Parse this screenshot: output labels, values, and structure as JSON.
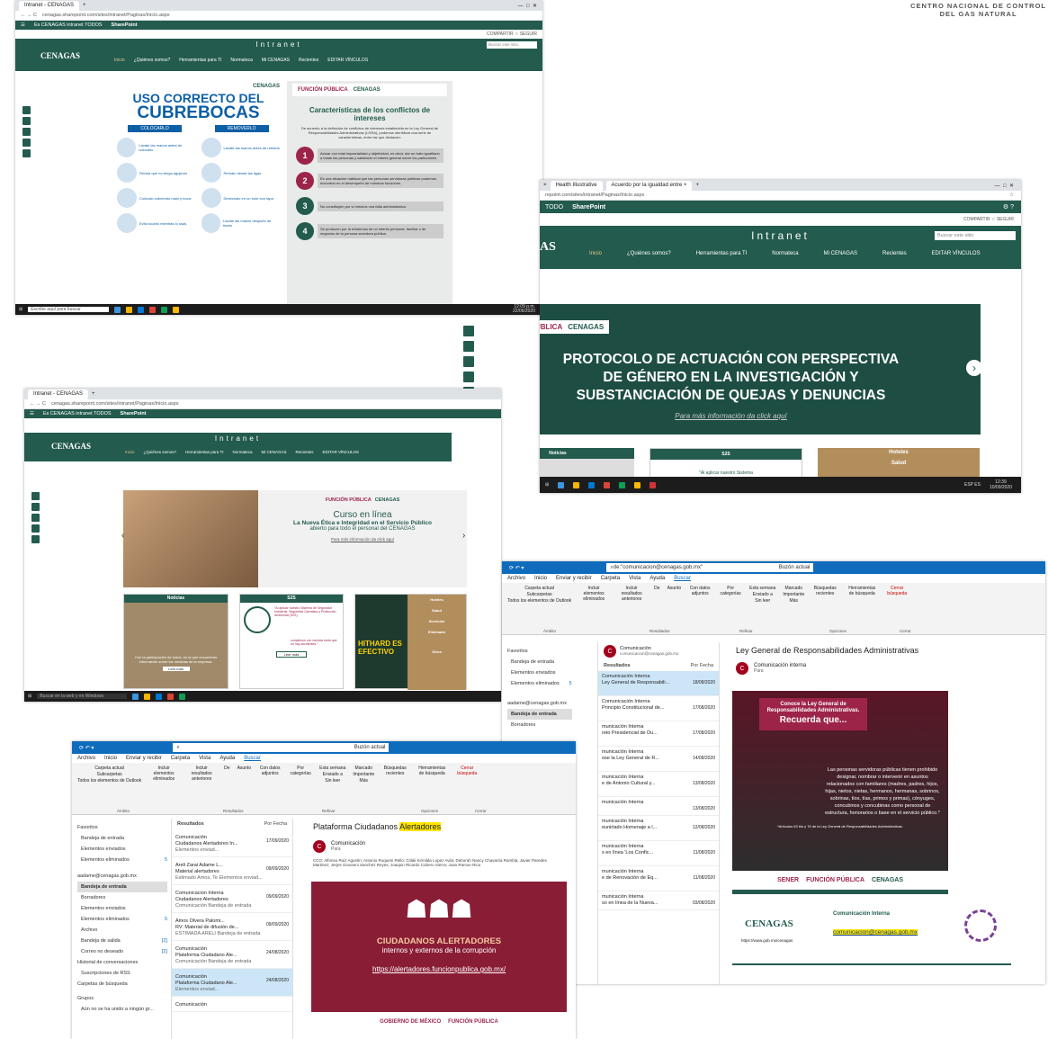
{
  "header_org": [
    "CENTRO NACIONAL DE CONTROL",
    "DEL GAS NATURAL"
  ],
  "s1": {
    "tab": "Intranet - CENAGAS",
    "url": "cenagas.sharepoint.com/sites/intranet/Paginas/Inicio.aspx",
    "sp_left": "Es CENAGAS intranet TODOS",
    "sp": "SharePoint",
    "share": "COMPARTIR ☆ SEGUIR",
    "intranet": "Intranet",
    "search": "Buscar este sitio",
    "logo": "CENAGAS",
    "nav": [
      "Inicio",
      "¿Quiénes somos?",
      "Herramientas para TI",
      "Normateca",
      "Mi CENAGAS",
      "Recientes",
      "EDITAR VÍNCULOS"
    ],
    "poster1": {
      "brand": "CENAGAS",
      "t1": "USO CORRECTO DEL",
      "t2": "CUBREBOCAS",
      "b1": "COLOCARLO",
      "b2": "REMOVERLO",
      "steps": [
        "Lávate las manos antes de colocarlo",
        "Revisa que no tenga agujeros",
        "Colócalo cubriendo nariz y boca",
        "Evita tocarlo mientras lo usas",
        "Lávate las manos antes de retirarlo",
        "Retíralo desde las ligas",
        "Deséchalo en un bote con tapa",
        "Lávate las manos después de tirarlo"
      ]
    },
    "poster2": {
      "fp": "FUNCIÓN PÚBLICA",
      "brand": "CENAGAS",
      "title": "Características de los conflictos de intereses",
      "intro": "De acuerdo a la definición de conflictos de intereses establecida en la Ley General de Responsabilidades Administrativas (LGRA), podemos identificar una serie de características, entre las que destacan:",
      "items": [
        {
          "n": "1",
          "t": "Actuar con total imparcialidad y objetividad, es decir, dar un trato igualitario a todas las personas y satisfacer el interés general sobre los particulares."
        },
        {
          "n": "2",
          "t": "Es una situación habitual que las personas servidoras públicas podemos encontrar en el desempeño de nuestras funciones."
        },
        {
          "n": "3",
          "t": "No constituyen por sí mismos una falta administrativa."
        },
        {
          "n": "4",
          "t": "Se producen por la existencia de un interés personal, familiar o de negocios de la persona servidora pública."
        }
      ]
    },
    "taskbar": "Escribe aquí para buscar",
    "time": "12:09 p.m.",
    "date": "22/06/2020"
  },
  "s2": {
    "tabs": [
      "Health Illustrative",
      "Acuerdo por la igualdad entre ×",
      "+"
    ],
    "url": "repoint.com/sites/intranet/Paginas/Inicio.aspx",
    "sp_left": "TODO",
    "sp": "SharePoint",
    "share": "COMPARTIR ☆ SEGUIR",
    "intranet": "Intranet",
    "search": "Buscar este sitio",
    "logo_frag": "AS",
    "nav": [
      "Inicio",
      "¿Quiénes somos?",
      "Herramientas para TI",
      "Normateca",
      "Mi CENAGAS",
      "Recientes",
      "EDITAR VÍNCULOS"
    ],
    "fp": "FUNCIÓN PÚBLICA",
    "brand": "CENAGAS",
    "b1": "PROTOCOLO DE ACTUACIÓN CON PERSPECTIVA",
    "b2": "DE GÉNERO EN LA INVESTIGACIÓN Y",
    "b3": "SUBSTANCIACIÓN DE QUEJAS Y DENUNCIAS",
    "link": "Para más información da click aquí",
    "cards": [
      "Noticias",
      "S2S",
      "Hoteles"
    ],
    "card_sub": "Salud",
    "card_text": "\"Al aplicar nuestro Sistema",
    "lang": "ESP ES",
    "time": "12:39",
    "date": "10/09/2020"
  },
  "s3": {
    "tab": "Intranet - CENAGAS",
    "url": "cenagas.sharepoint.com/sites/intranet/Paginas/Inicio.aspx",
    "sp_left": "Es CENAGAS intranet TODOS",
    "sp": "SharePoint",
    "intranet": "Intranet",
    "logo": "CENAGAS",
    "nav": [
      "Inicio",
      "¿Quiénes somos?",
      "Herramientas para TI",
      "Normateca",
      "Mi CENAGAS",
      "Recientes",
      "EDITAR VÍNCULOS"
    ],
    "fp": "FUNCIÓN PÚBLICA",
    "brand": "CENAGAS",
    "c1": "Curso en línea",
    "c2": "La Nueva Ética e Integridad en el Servicio Público",
    "c3": "abierto para todo el personal del CENAGAS",
    "c4": "Para más información da click aquí",
    "cards": [
      "Noticias",
      "S2S",
      "Hoteles"
    ],
    "right_items": [
      "Salud",
      "Servicios",
      "Eliminado",
      "Otros"
    ],
    "news": "Con la participación de todos, en la que encuentras información sobre las medidas de la empresa.",
    "read": "Leer más",
    "s2s": "\"Al aplicar nuestro Sistema de Seguridad Industrial, Seguridad Operativa y Protección Ambiental (S2S),",
    "s2s2": "cumplimos con nuestra meta que no hay accidentes.\"",
    "hithard": "HITHARD ES EFECTIVO",
    "taskbar": "Buscar en la web y en Windows"
  },
  "s4": {
    "search": "de:\"comunicacion@cenagas.gob.mx\"",
    "scope": "Buzón actual",
    "menu": [
      "Archivo",
      "Inicio",
      "Enviar y recibir",
      "Carpeta",
      "Vista",
      "Ayuda",
      "Buscar"
    ],
    "ribbon": [
      "Carpeta actual",
      "Subcarpetas",
      "Todos los elementos de Outlook",
      "Incluir elementos eliminados",
      "Incluir resultados anteriores",
      "De",
      "Asunto",
      "Con datos adjuntos",
      "Por categorías",
      "Esta semana",
      "Enviado a",
      "Sin leer",
      "Marcado",
      "Importante",
      "Más",
      "Búsquedas recientes",
      "Herramientas de búsqueda",
      "Cerrar búsqueda"
    ],
    "groups": [
      "Ámbito",
      "Resultados",
      "Refinar",
      "Opciones",
      "Cerrar"
    ],
    "folders": [
      "Favoritos",
      "Bandeja de entrada",
      "Elementos enviados",
      "Elementos eliminados",
      "aadame@cenagas.gob.mx",
      "Bandeja de entrada",
      "Borradores"
    ],
    "count": "5",
    "sender": "Comunicación",
    "sender_mail": "comunicacion@cenagas.gob.mx",
    "results": "Resultados",
    "sort": "Por Fecha",
    "msgs": [
      {
        "f": "Comunicación Interna",
        "s": "Ley General de Responsabili...",
        "d": "18/08/2020"
      },
      {
        "f": "Comunicación Interna",
        "s": "Principio Constitucional de...",
        "d": "17/08/2020"
      },
      {
        "f": "municación Interna",
        "s": "reto Presidencial de Du...",
        "d": "17/08/2020"
      },
      {
        "f": "municación Interna",
        "s": "ose la Ley General de R...",
        "d": "14/08/2020"
      },
      {
        "f": "municación Interna",
        "s": "e de Antonio Cultural y...",
        "d": "13/08/2020"
      },
      {
        "f": "municación Interna",
        "s": "",
        "d": "13/08/2020"
      },
      {
        "f": "municación Interna",
        "s": "eunirlado Homenaje a l...",
        "d": "12/08/2020"
      },
      {
        "f": "municación Interna",
        "s": "s en línea 'Los Confic...",
        "d": "11/08/2020"
      },
      {
        "f": "municación Interna",
        "s": "e de Renovación de Eq...",
        "d": "11/08/2020"
      },
      {
        "f": "municación Interna",
        "s": "so en línea de la Nueva...",
        "d": "03/08/2020"
      }
    ],
    "inbox": "Bandeja de entrada",
    "subject": "Ley General de Responsabilidades Administrativas",
    "from": "Comunicación interna",
    "to": "Para",
    "poster": {
      "t1": "Conoce la Ley General de Responsabilidades Administrativas.",
      "t2": "Recuerda que...",
      "body": "Las personas servidoras públicas tienen prohibido designar, nombrar o intervenir en asuntos relacionados con familiares (madres, padres, hijos, hijas, nietos, nietas, hermanos, hermanas, sobrinos, sobrinas, tíos, tías, primos y primas), cónyuges, concubinos y concubinas como personal de estructura, honorarios o base en el servicio público.*",
      "foot": "*Artículos 63 bis y 76 de la Ley General de Responsabilidades Administrativas.",
      "logos": [
        "SENER",
        "FUNCIÓN PÚBLICA",
        "CENAGAS"
      ]
    },
    "sig": {
      "brand": "CENAGAS",
      "web": "https://www.gob.mx/cenagas",
      "ci": "Comunicación Interna",
      "mail": "comunicacion@cenagas.gob.mx"
    }
  },
  "s5": {
    "search": "",
    "scope": "Buzón actual",
    "menu": [
      "Archivo",
      "Inicio",
      "Enviar y recibir",
      "Carpeta",
      "Vista",
      "Ayuda",
      "Buscar"
    ],
    "ribbon": [
      "Carpeta actual",
      "Subcarpetas",
      "Todos los elementos de Outlook",
      "Incluir elementos eliminados",
      "Incluir resultados anteriores",
      "De",
      "Asunto",
      "Con datos adjuntos",
      "Por categorías",
      "Esta semana",
      "Enviado a",
      "Sin leer",
      "Marcado",
      "Importante",
      "Más",
      "Búsquedas recientes",
      "Herramientas de búsqueda",
      "Cerrar búsqueda"
    ],
    "groups": [
      "Ámbito",
      "Resultados",
      "Refinar",
      "Opciones",
      "Cerrar"
    ],
    "folders": [
      "Favoritos",
      "Bandeja de entrada",
      "Elementos enviados",
      "Elementos eliminados",
      "aadame@cenagas.gob.mx",
      "Bandeja de entrada",
      "Borradores",
      "Elementos enviados",
      "Elementos eliminados",
      "Archivo",
      "Bandeja de salida",
      "Correo no deseado",
      "Historial de conversaciones",
      "Suscripciones de RSS",
      "Carpetas de búsqueda",
      "Grupos",
      "Aún no se ha unido a ningún gr..."
    ],
    "counts": [
      "5",
      "5",
      "[2]",
      "[2]"
    ],
    "results": "Resultados",
    "sort": "Por Fecha",
    "msgs": [
      {
        "f": "Comunicación",
        "s": "Ciudadanos Alertadores In...",
        "d": "17/09/2020",
        "x": "Elementos enviad..."
      },
      {
        "f": "Areli Zarai Adame L...",
        "s": "Material alertadores",
        "d": "09/09/2020",
        "x": "Estimado Amos, Te   Elementos enviad..."
      },
      {
        "f": "Comunicacion Interna",
        "s": "Ciudadanos Alertadores",
        "d": "09/09/2020",
        "x": "Comunicación   Bandeja de entrada"
      },
      {
        "f": "Amos Olvera Palomi...",
        "s": "RV: Material de difusión de...",
        "d": "09/09/2020",
        "x": "ESTIMADA ARELI   Bandeja de entrada"
      },
      {
        "f": "Comunicación",
        "s": "Plataforma Ciudadano Ale...",
        "d": "24/08/2020",
        "x": "Comunicación   Bandeja de entrada"
      },
      {
        "f": "Comunicación",
        "s": "Plataforma Ciudadano Ale...",
        "d": "24/08/2020",
        "x": "Elementos enviad..."
      },
      {
        "f": "Comunicación",
        "s": "",
        "d": "",
        "x": ""
      }
    ],
    "subject_a": "Plataforma Ciudadanos ",
    "subject_b": "Alertadores",
    "from": "Comunicación",
    "to": "Para",
    "cc": "CCO:  Alfonso Ruiz Agustín; Antonio Roqueni Rello; Citlali Kirmilda Lopez Avila; Deborah Nancy Chavarria Rambla; Javier Paredes Martinez; Jerjes Giovanni Sanchez Reyes; Joaquin Ricardo Cubero Sierra; Juan Ramon Rica",
    "poster": {
      "t1": "CIUDADANOS ALERTADORES",
      "t2": "internos y externos de la corrupción",
      "link": "https://alertadores.funcionpublica.gob.mx/",
      "foot1": "GOBIERNO DE MÉXICO",
      "foot2": "FUNCIÓN PÚBLICA"
    }
  }
}
